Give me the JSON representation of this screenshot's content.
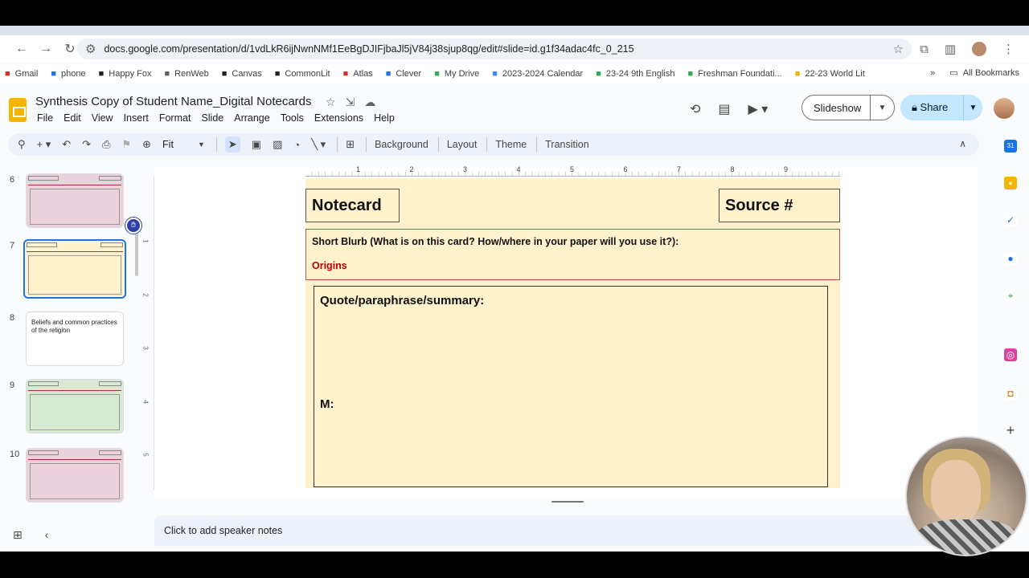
{
  "browser": {
    "url": "docs.google.com/presentation/d/1vdLkR6ijNwnNMf1EeBgDJIFjbaJl5jV84j38sjup8qg/edit#slide=id.g1f34adac4fc_0_215",
    "bookmarks": [
      {
        "label": "Gmail",
        "icon": "gmail-icon",
        "color": "#d93025"
      },
      {
        "label": "phone",
        "icon": "chevron-icon",
        "color": "#1a73e8"
      },
      {
        "label": "Happy Fox",
        "icon": "r-icon",
        "color": "#202124"
      },
      {
        "label": "RenWeb",
        "icon": "renweb-icon",
        "color": "#5f6368"
      },
      {
        "label": "Canvas",
        "icon": "r-icon",
        "color": "#202124"
      },
      {
        "label": "CommonLit",
        "icon": "book-icon",
        "color": "#202124"
      },
      {
        "label": "Atlas",
        "icon": "atlas-icon",
        "color": "#d93025"
      },
      {
        "label": "Clever",
        "icon": "clever-icon",
        "color": "#1a73e8"
      },
      {
        "label": "My Drive",
        "icon": "drive-icon",
        "color": "#34a853"
      },
      {
        "label": "2023-2024 Calendar",
        "icon": "docs-icon",
        "color": "#4285f4"
      },
      {
        "label": "23-24 9th English",
        "icon": "drive-icon",
        "color": "#34a853"
      },
      {
        "label": "Freshman Foundati...",
        "icon": "drive-icon",
        "color": "#34a853"
      },
      {
        "label": "22-23 World Lit",
        "icon": "drive-icon",
        "color": "#f4b400"
      }
    ],
    "more_bookmarks": "»",
    "all_bookmarks": "All Bookmarks"
  },
  "app": {
    "title": "Synthesis Copy of Student Name_Digital Notecards",
    "menu": [
      "File",
      "Edit",
      "View",
      "Insert",
      "Format",
      "Slide",
      "Arrange",
      "Tools",
      "Extensions",
      "Help"
    ],
    "slideshow_label": "Slideshow",
    "share_label": "Share"
  },
  "toolbar": {
    "zoom": "Fit",
    "background": "Background",
    "layout": "Layout",
    "theme": "Theme",
    "transition": "Transition"
  },
  "sidebar": {
    "slides": [
      {
        "num": "6",
        "color": "#ead1dc",
        "selected": false
      },
      {
        "num": "7",
        "color": "#fff2cc",
        "selected": true
      },
      {
        "num": "8",
        "color": "#ffffff",
        "selected": false,
        "text": "Beliefs and common practices of the religion"
      },
      {
        "num": "9",
        "color": "#d9ead3",
        "selected": false
      },
      {
        "num": "10",
        "color": "#ead1dc",
        "selected": false
      }
    ]
  },
  "rulers": {
    "horizontal": [
      "1",
      "2",
      "3",
      "4",
      "5",
      "6",
      "7",
      "8",
      "9"
    ],
    "vertical": [
      "1",
      "2",
      "3",
      "4",
      "5"
    ]
  },
  "slide": {
    "notecard": "Notecard",
    "source": "Source #",
    "blurb_label": "Short Blurb (What is on this card? How/where in your paper will you use it?):",
    "blurb_value": "Origins",
    "quote_label": "Quote/paraphrase/summary:",
    "m_label": "M:"
  },
  "notes": {
    "placeholder": "Click to add speaker notes"
  },
  "colors": {
    "slide_bg": "#fff2cc",
    "accent_blue": "#1a73e8",
    "share_bg": "#c2e7ff",
    "blurb_red": "#c00000"
  }
}
